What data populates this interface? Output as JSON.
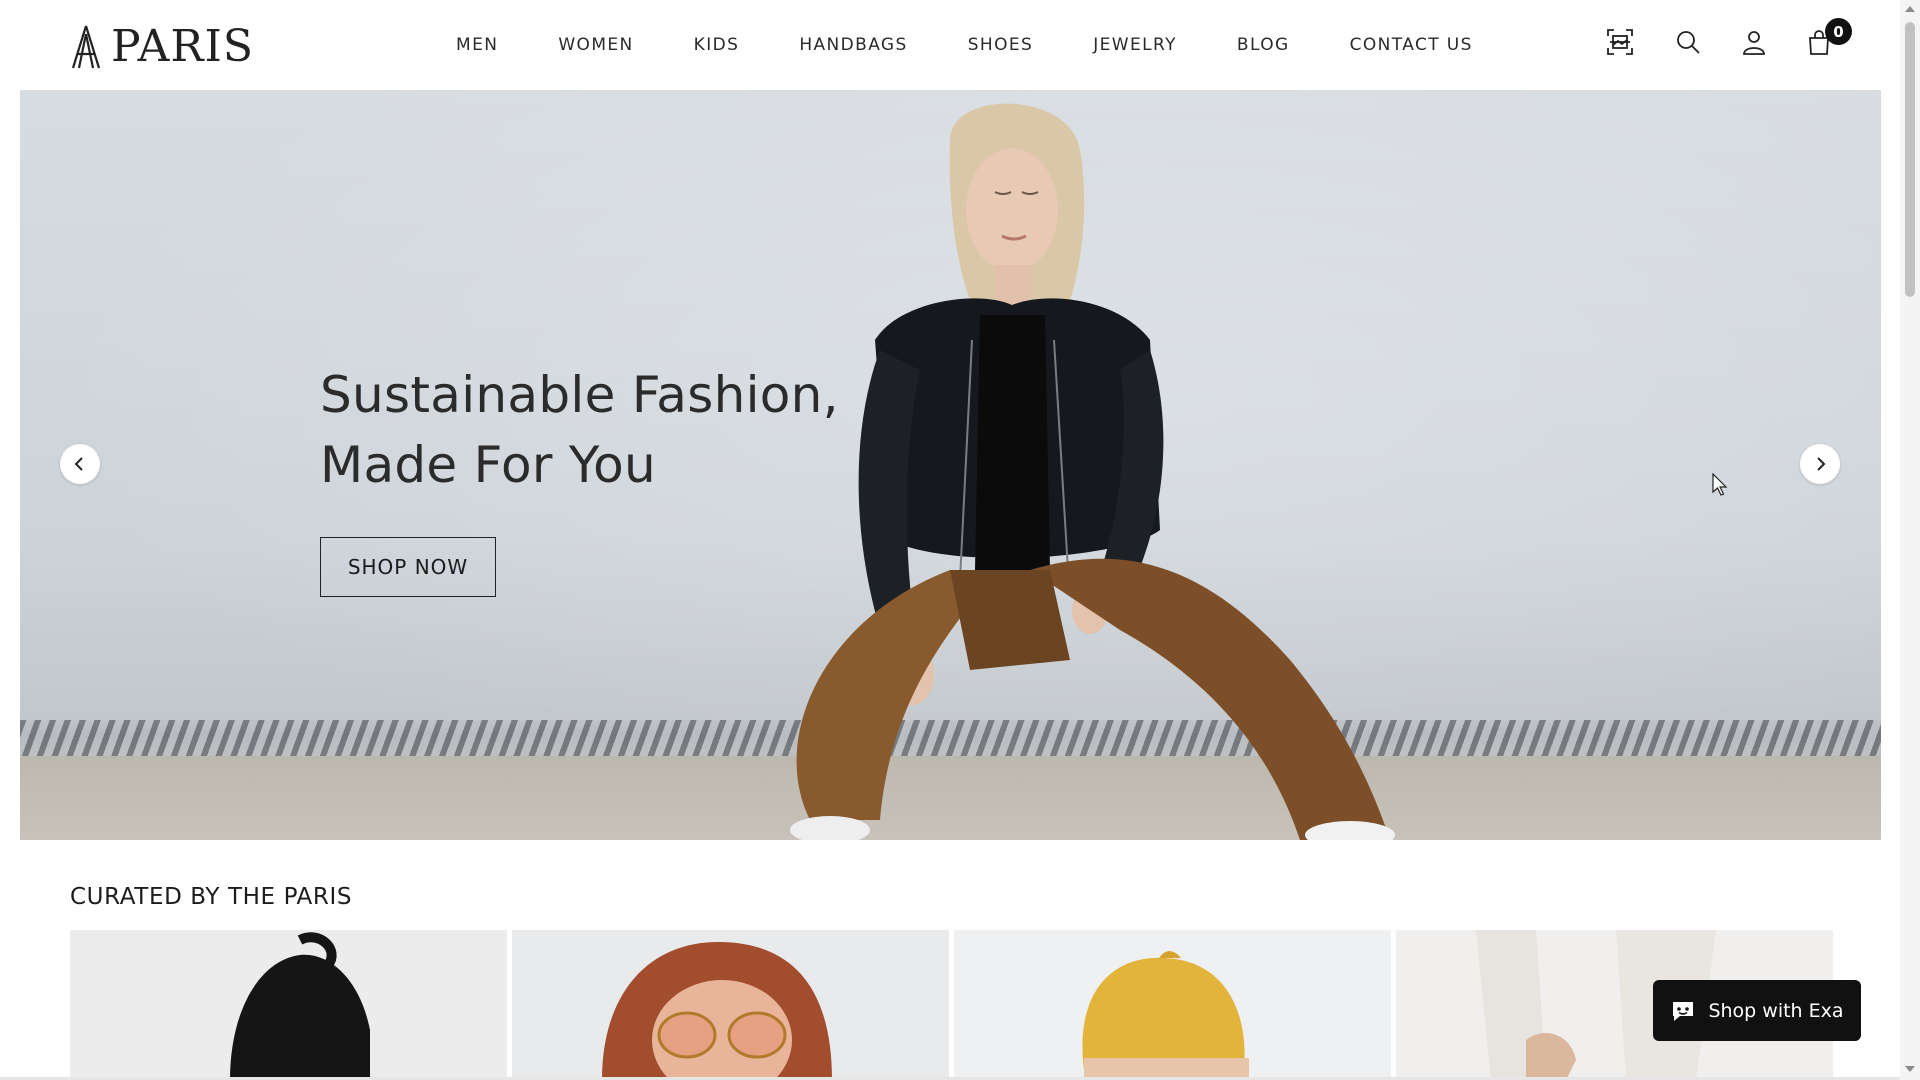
{
  "header": {
    "logo_text": "PARIS",
    "nav": [
      "MEN",
      "WOMEN",
      "KIDS",
      "HANDBAGS",
      "SHOES",
      "JEWELRY",
      "BLOG",
      "CONTACT US"
    ],
    "icons": [
      "visual-search-icon",
      "search-icon",
      "account-icon",
      "cart-icon"
    ],
    "cart_count": "0"
  },
  "hero": {
    "heading_line1": "Sustainable Fashion,",
    "heading_line2": "Made For You",
    "cta_label": "SHOP NOW",
    "prev_icon": "chevron-left-icon",
    "next_icon": "chevron-right-icon"
  },
  "curated": {
    "title": "CURATED BY THE PARIS"
  },
  "chat": {
    "label": "Shop with Exa",
    "icon": "chat-icon"
  },
  "colors": {
    "text": "#1c1c1c",
    "badge": "#111111",
    "chat_bg": "#111111",
    "hero_wall": "#d4d9de"
  }
}
